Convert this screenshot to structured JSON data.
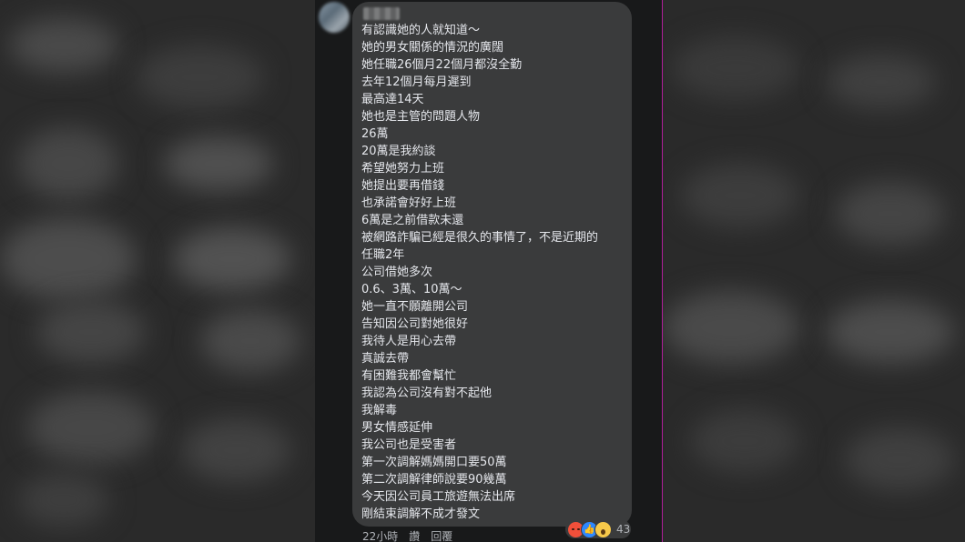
{
  "comment": {
    "lines": [
      "有認識她的人就知道～",
      "她的男女關係的情況的廣闊",
      "她任職26個月22個月都沒全勤",
      "去年12個月每月遲到",
      "最高達14天",
      "她也是主管的問題人物",
      "26萬",
      "20萬是我約談",
      "希望她努力上班",
      "她提出要再借錢",
      "也承諾會好好上班",
      "6萬是之前借款未還",
      "被網路詐騙已經是很久的事情了，不是近期的",
      "任職2年",
      "公司借她多次",
      "0.6、3萬、10萬～",
      "她一直不願離開公司",
      "告知因公司對她很好",
      "我待人是用心去帶",
      "真誠去帶",
      "有困難我都會幫忙",
      "我認為公司沒有對不起他",
      "我解毒",
      "男女情感延伸",
      "我公司也是受害者",
      "第一次調解媽媽開口要50萬",
      "第二次調解律師說要90幾萬",
      "今天因公司員工旅遊無法出席",
      "剛結束調解不成才發文"
    ],
    "reactions": {
      "count": "43",
      "icons": [
        "angry-icon",
        "like-icon",
        "wow-icon"
      ]
    },
    "meta": {
      "time": "22小時",
      "like_label": "讚",
      "reply_label": "回覆"
    }
  },
  "colors": {
    "bubble": "#3a3b3c",
    "text": "#e4e6eb",
    "secondary_text": "#b0b3b8",
    "divider": "#b01e9a"
  }
}
